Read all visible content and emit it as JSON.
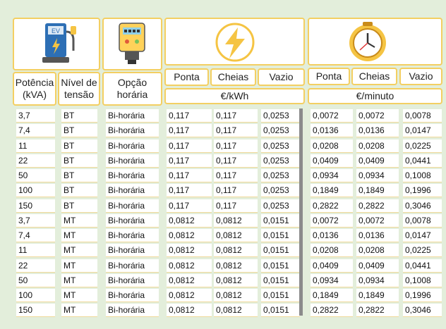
{
  "headers": {
    "potencia": "Potência (kVA)",
    "nivel": "Nível de tensão",
    "opcao": "Opção horária",
    "energy": {
      "ponta": "Ponta",
      "cheias": "Cheias",
      "vazio": "Vazio",
      "unit": "€/kWh"
    },
    "time": {
      "ponta": "Ponta",
      "cheias": "Cheias",
      "vazio": "Vazio",
      "unit": "€/minuto"
    }
  },
  "icons": {
    "charger": "ev-charger-icon",
    "charger_label": "EV",
    "meter": "electric-meter-icon",
    "bolt": "lightning-bolt-icon",
    "clock": "clock-icon"
  },
  "colors": {
    "accent_border": "#f3cf62",
    "background": "#e3eedb"
  },
  "rows": [
    [
      "3,7",
      "BT",
      "Bi-horária",
      "0,117",
      "0,117",
      "0,0253",
      "0,0072",
      "0,0072",
      "0,0078"
    ],
    [
      "7,4",
      "BT",
      "Bi-horária",
      "0,117",
      "0,117",
      "0,0253",
      "0,0136",
      "0,0136",
      "0,0147"
    ],
    [
      "11",
      "BT",
      "Bi-horária",
      "0,117",
      "0,117",
      "0,0253",
      "0,0208",
      "0,0208",
      "0,0225"
    ],
    [
      "22",
      "BT",
      "Bi-horária",
      "0,117",
      "0,117",
      "0,0253",
      "0,0409",
      "0,0409",
      "0,0441"
    ],
    [
      "50",
      "BT",
      "Bi-horária",
      "0,117",
      "0,117",
      "0,0253",
      "0,0934",
      "0,0934",
      "0,1008"
    ],
    [
      "100",
      "BT",
      "Bi-horária",
      "0,117",
      "0,117",
      "0,0253",
      "0,1849",
      "0,1849",
      "0,1996"
    ],
    [
      "150",
      "BT",
      "Bi-horária",
      "0,117",
      "0,117",
      "0,0253",
      "0,2822",
      "0,2822",
      "0,3046"
    ],
    [
      "3,7",
      "MT",
      "Bi-horária",
      "0,0812",
      "0,0812",
      "0,0151",
      "0,0072",
      "0,0072",
      "0,0078"
    ],
    [
      "7,4",
      "MT",
      "Bi-horária",
      "0,0812",
      "0,0812",
      "0,0151",
      "0,0136",
      "0,0136",
      "0,0147"
    ],
    [
      "11",
      "MT",
      "Bi-horária",
      "0,0812",
      "0,0812",
      "0,0151",
      "0,0208",
      "0,0208",
      "0,0225"
    ],
    [
      "22",
      "MT",
      "Bi-horária",
      "0,0812",
      "0,0812",
      "0,0151",
      "0,0409",
      "0,0409",
      "0,0441"
    ],
    [
      "50",
      "MT",
      "Bi-horária",
      "0,0812",
      "0,0812",
      "0,0151",
      "0,0934",
      "0,0934",
      "0,1008"
    ],
    [
      "100",
      "MT",
      "Bi-horária",
      "0,0812",
      "0,0812",
      "0,0151",
      "0,1849",
      "0,1849",
      "0,1996"
    ],
    [
      "150",
      "MT",
      "Bi-horária",
      "0,0812",
      "0,0812",
      "0,0151",
      "0,2822",
      "0,2822",
      "0,3046"
    ]
  ]
}
